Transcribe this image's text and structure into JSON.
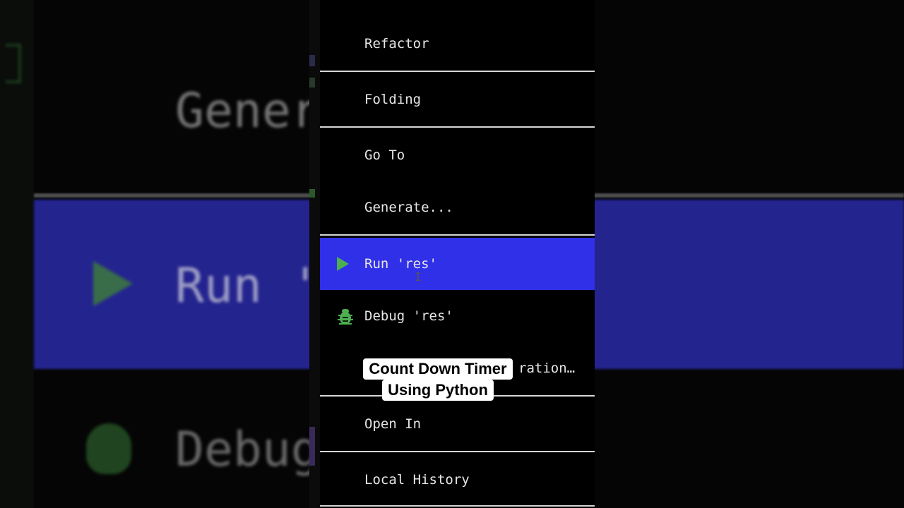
{
  "background": {
    "generate_text": "Gener",
    "run_text": "Run '",
    "debug_text": "Debug"
  },
  "menu": {
    "items": [
      {
        "label": "Refactor"
      },
      {
        "label": "Folding"
      },
      {
        "label": "Go To"
      },
      {
        "label": "Generate..."
      },
      {
        "label": "Run 'res'",
        "icon": "play-icon",
        "selected": true
      },
      {
        "label": "Debug 'res'",
        "icon": "bug-icon"
      },
      {
        "label": "ration…"
      },
      {
        "label": "Open In"
      },
      {
        "label": "Local History"
      }
    ]
  },
  "caption": {
    "line1": "Count Down Timer",
    "line2": "Using Python"
  },
  "colors": {
    "selection": "#3030e8",
    "icon_green": "#4caf50",
    "menu_bg": "#000000",
    "separator": "#d6d6d6"
  }
}
